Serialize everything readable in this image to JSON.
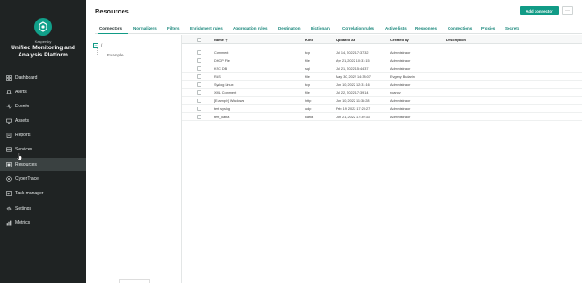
{
  "brand": {
    "small": "Kaspersky",
    "title": "Unified Monitoring and Analysis Platform"
  },
  "sidebar": {
    "items": [
      {
        "label": "Dashboard",
        "icon": "dashboard-icon"
      },
      {
        "label": "Alerts",
        "icon": "bell-icon"
      },
      {
        "label": "Events",
        "icon": "events-icon"
      },
      {
        "label": "Assets",
        "icon": "assets-icon"
      },
      {
        "label": "Reports",
        "icon": "reports-icon"
      },
      {
        "label": "Services",
        "icon": "services-icon"
      },
      {
        "label": "Resources",
        "icon": "resources-icon"
      },
      {
        "label": "CyberTrace",
        "icon": "cybertrace-icon"
      },
      {
        "label": "Task manager",
        "icon": "task-manager-icon"
      },
      {
        "label": "Settings",
        "icon": "gear-icon"
      },
      {
        "label": "Metrics",
        "icon": "metrics-icon"
      }
    ],
    "active": "Resources"
  },
  "header": {
    "title": "Resources",
    "add_button": "Add connector",
    "more_button": "···"
  },
  "tabs": [
    "Connectors",
    "Normalizers",
    "Filters",
    "Enrichment rules",
    "Aggregation rules",
    "Destination",
    "Dictionary",
    "Correlation rules",
    "Active lists",
    "Responses",
    "Connections",
    "Proxies",
    "Secrets"
  ],
  "active_tab": "Connectors",
  "tree": {
    "root": "/",
    "child": "Example",
    "toggle": "–"
  },
  "table": {
    "columns": {
      "name": "Name",
      "kind": "Kind",
      "updated": "Updated At",
      "created_by": "Created by",
      "description": "Description"
    },
    "rows": [
      {
        "name": "Comment",
        "kind": "tcp",
        "updated": "Jul 14, 2022 17:37:32",
        "created_by": "Administrator"
      },
      {
        "name": "DHCP File",
        "kind": "file",
        "updated": "Apr 21, 2022 10:31:15",
        "created_by": "Administrator"
      },
      {
        "name": "KSC DB",
        "kind": "sql",
        "updated": "Jul 21, 2022 15:44:37",
        "created_by": "Administrator"
      },
      {
        "name": "RAS",
        "kind": "file",
        "updated": "May 30, 2022 14:38:07",
        "created_by": "Evgeny Budarin"
      },
      {
        "name": "Syslog Linux",
        "kind": "tcp",
        "updated": "Jun 10, 2022 12:31:16",
        "created_by": "Administrator"
      },
      {
        "name": "XML Comment",
        "kind": "file",
        "updated": "Jul 22, 2022 17:39:14",
        "created_by": "roanov"
      },
      {
        "name": "[Example] Windows",
        "kind": "http",
        "updated": "Jun 10, 2022 11:38:28",
        "created_by": "Administrator"
      },
      {
        "name": "test syslog",
        "kind": "udp",
        "updated": "Feb 19, 2022 17:20:27",
        "created_by": "Administrator"
      },
      {
        "name": "test_kafka",
        "kind": "kafka",
        "updated": "Jun 21, 2022 17:39:33",
        "created_by": "Administrator"
      }
    ]
  },
  "colors": {
    "sidebar_bg": "#1f2323",
    "accent": "#119b86",
    "tab_text": "#17867a"
  }
}
